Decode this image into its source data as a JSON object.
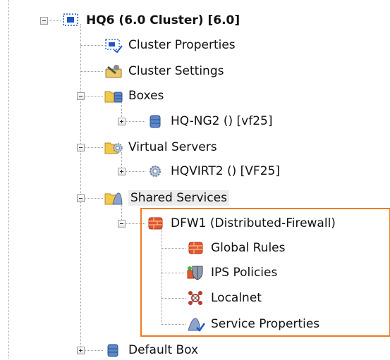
{
  "tree": {
    "root": {
      "label": "HQ6 (6.0 Cluster) [6.0]",
      "icon": "cluster-icon"
    },
    "cluster_properties": {
      "label": "Cluster Properties",
      "icon": "properties-icon"
    },
    "cluster_settings": {
      "label": "Cluster Settings",
      "icon": "settings-icon"
    },
    "boxes": {
      "label": "Boxes",
      "icon": "folder-database-icon"
    },
    "hq_ng2": {
      "label": "HQ-NG2 () [vf25]",
      "icon": "database-icon"
    },
    "virtual_servers": {
      "label": "Virtual Servers",
      "icon": "folder-gear-icon"
    },
    "hqvirt2": {
      "label": "HQVIRT2 () [VF25]",
      "icon": "gear-icon"
    },
    "shared_services": {
      "label": "Shared Services",
      "icon": "folder-service-icon"
    },
    "dfw1": {
      "label": "DFW1 (Distributed-Firewall)",
      "icon": "firewall-icon"
    },
    "global_rules": {
      "label": "Global Rules",
      "icon": "firewall-icon"
    },
    "ips_policies": {
      "label": "IPS Policies",
      "icon": "shield-icon"
    },
    "localnet": {
      "label": "Localnet",
      "icon": "network-icon"
    },
    "service_properties": {
      "label": "Service Properties",
      "icon": "service-properties-icon"
    },
    "default_box": {
      "label": "Default Box",
      "icon": "database-icon"
    }
  },
  "colors": {
    "highlight": "#f07a1e"
  }
}
